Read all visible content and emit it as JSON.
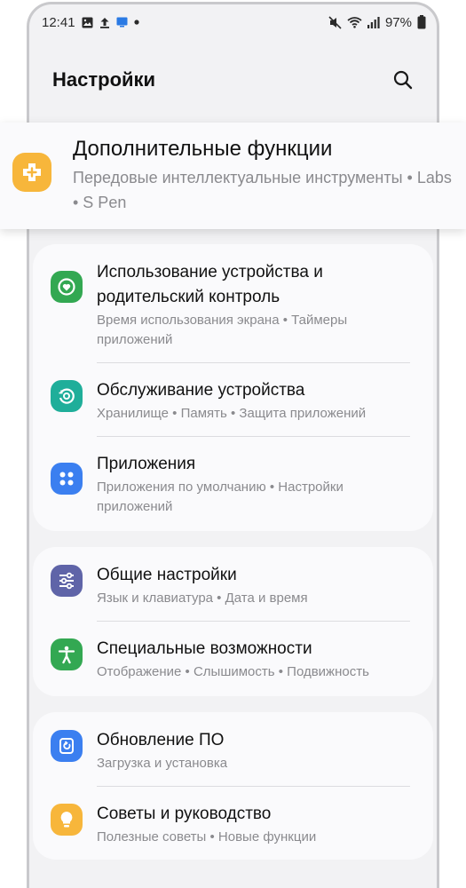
{
  "status_bar": {
    "time": "12:41",
    "battery": "97%",
    "icons": [
      "image-icon",
      "upload-icon",
      "cast-icon",
      "dot-icon",
      "mute-icon",
      "wifi-icon",
      "signal-icon",
      "battery-icon"
    ]
  },
  "header": {
    "title": "Настройки",
    "search_icon": "search-icon"
  },
  "highlight_item": {
    "title": "Дополнительные функции",
    "subtitle": "Передовые интеллектуальные инструменты • Labs • S Pen",
    "icon": "plus-puzzle-icon",
    "icon_color": "#f7b63b"
  },
  "groups": [
    {
      "items": [
        {
          "title": "Использование устройства и родительский контроль",
          "subtitle": "Время использования экрана • Таймеры приложений",
          "icon": "digital-wellbeing-icon",
          "icon_color": "#33a852"
        },
        {
          "title": "Обслуживание устройства",
          "subtitle": "Хранилище • Память • Защита приложений",
          "icon": "device-care-icon",
          "icon_color": "#1fae9a"
        },
        {
          "title": "Приложения",
          "subtitle": "Приложения по умолчанию • Настройки приложений",
          "icon": "apps-icon",
          "icon_color": "#3b7ff0"
        }
      ]
    },
    {
      "items": [
        {
          "title": "Общие настройки",
          "subtitle": "Язык и клавиатура • Дата и время",
          "icon": "sliders-icon",
          "icon_color": "#5f64a8"
        },
        {
          "title": "Специальные возможности",
          "subtitle": "Отображение • Слышимость • Подвижность",
          "icon": "accessibility-icon",
          "icon_color": "#33a852"
        }
      ]
    },
    {
      "items": [
        {
          "title": "Обновление ПО",
          "subtitle": "Загрузка и установка",
          "icon": "software-update-icon",
          "icon_color": "#3b7ff0"
        },
        {
          "title": "Советы и руководство",
          "subtitle": "Полезные советы • Новые функции",
          "icon": "lightbulb-icon",
          "icon_color": "#f7b63b"
        }
      ]
    }
  ]
}
